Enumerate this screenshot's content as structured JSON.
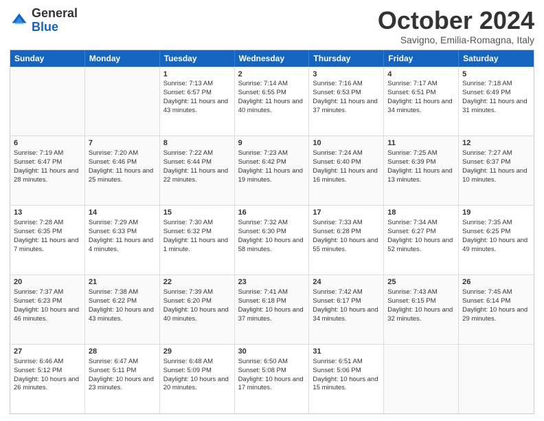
{
  "logo": {
    "general": "General",
    "blue": "Blue"
  },
  "title": "October 2024",
  "location": "Savigno, Emilia-Romagna, Italy",
  "days": [
    "Sunday",
    "Monday",
    "Tuesday",
    "Wednesday",
    "Thursday",
    "Friday",
    "Saturday"
  ],
  "weeks": [
    [
      {
        "day": "",
        "sunrise": "",
        "sunset": "",
        "daylight": "",
        "empty": true
      },
      {
        "day": "",
        "sunrise": "",
        "sunset": "",
        "daylight": "",
        "empty": true
      },
      {
        "day": "1",
        "sunrise": "Sunrise: 7:13 AM",
        "sunset": "Sunset: 6:57 PM",
        "daylight": "Daylight: 11 hours and 43 minutes."
      },
      {
        "day": "2",
        "sunrise": "Sunrise: 7:14 AM",
        "sunset": "Sunset: 6:55 PM",
        "daylight": "Daylight: 11 hours and 40 minutes."
      },
      {
        "day": "3",
        "sunrise": "Sunrise: 7:16 AM",
        "sunset": "Sunset: 6:53 PM",
        "daylight": "Daylight: 11 hours and 37 minutes."
      },
      {
        "day": "4",
        "sunrise": "Sunrise: 7:17 AM",
        "sunset": "Sunset: 6:51 PM",
        "daylight": "Daylight: 11 hours and 34 minutes."
      },
      {
        "day": "5",
        "sunrise": "Sunrise: 7:18 AM",
        "sunset": "Sunset: 6:49 PM",
        "daylight": "Daylight: 11 hours and 31 minutes."
      }
    ],
    [
      {
        "day": "6",
        "sunrise": "Sunrise: 7:19 AM",
        "sunset": "Sunset: 6:47 PM",
        "daylight": "Daylight: 11 hours and 28 minutes."
      },
      {
        "day": "7",
        "sunrise": "Sunrise: 7:20 AM",
        "sunset": "Sunset: 6:46 PM",
        "daylight": "Daylight: 11 hours and 25 minutes."
      },
      {
        "day": "8",
        "sunrise": "Sunrise: 7:22 AM",
        "sunset": "Sunset: 6:44 PM",
        "daylight": "Daylight: 11 hours and 22 minutes."
      },
      {
        "day": "9",
        "sunrise": "Sunrise: 7:23 AM",
        "sunset": "Sunset: 6:42 PM",
        "daylight": "Daylight: 11 hours and 19 minutes."
      },
      {
        "day": "10",
        "sunrise": "Sunrise: 7:24 AM",
        "sunset": "Sunset: 6:40 PM",
        "daylight": "Daylight: 11 hours and 16 minutes."
      },
      {
        "day": "11",
        "sunrise": "Sunrise: 7:25 AM",
        "sunset": "Sunset: 6:39 PM",
        "daylight": "Daylight: 11 hours and 13 minutes."
      },
      {
        "day": "12",
        "sunrise": "Sunrise: 7:27 AM",
        "sunset": "Sunset: 6:37 PM",
        "daylight": "Daylight: 11 hours and 10 minutes."
      }
    ],
    [
      {
        "day": "13",
        "sunrise": "Sunrise: 7:28 AM",
        "sunset": "Sunset: 6:35 PM",
        "daylight": "Daylight: 11 hours and 7 minutes."
      },
      {
        "day": "14",
        "sunrise": "Sunrise: 7:29 AM",
        "sunset": "Sunset: 6:33 PM",
        "daylight": "Daylight: 11 hours and 4 minutes."
      },
      {
        "day": "15",
        "sunrise": "Sunrise: 7:30 AM",
        "sunset": "Sunset: 6:32 PM",
        "daylight": "Daylight: 11 hours and 1 minute."
      },
      {
        "day": "16",
        "sunrise": "Sunrise: 7:32 AM",
        "sunset": "Sunset: 6:30 PM",
        "daylight": "Daylight: 10 hours and 58 minutes."
      },
      {
        "day": "17",
        "sunrise": "Sunrise: 7:33 AM",
        "sunset": "Sunset: 6:28 PM",
        "daylight": "Daylight: 10 hours and 55 minutes."
      },
      {
        "day": "18",
        "sunrise": "Sunrise: 7:34 AM",
        "sunset": "Sunset: 6:27 PM",
        "daylight": "Daylight: 10 hours and 52 minutes."
      },
      {
        "day": "19",
        "sunrise": "Sunrise: 7:35 AM",
        "sunset": "Sunset: 6:25 PM",
        "daylight": "Daylight: 10 hours and 49 minutes."
      }
    ],
    [
      {
        "day": "20",
        "sunrise": "Sunrise: 7:37 AM",
        "sunset": "Sunset: 6:23 PM",
        "daylight": "Daylight: 10 hours and 46 minutes."
      },
      {
        "day": "21",
        "sunrise": "Sunrise: 7:38 AM",
        "sunset": "Sunset: 6:22 PM",
        "daylight": "Daylight: 10 hours and 43 minutes."
      },
      {
        "day": "22",
        "sunrise": "Sunrise: 7:39 AM",
        "sunset": "Sunset: 6:20 PM",
        "daylight": "Daylight: 10 hours and 40 minutes."
      },
      {
        "day": "23",
        "sunrise": "Sunrise: 7:41 AM",
        "sunset": "Sunset: 6:18 PM",
        "daylight": "Daylight: 10 hours and 37 minutes."
      },
      {
        "day": "24",
        "sunrise": "Sunrise: 7:42 AM",
        "sunset": "Sunset: 6:17 PM",
        "daylight": "Daylight: 10 hours and 34 minutes."
      },
      {
        "day": "25",
        "sunrise": "Sunrise: 7:43 AM",
        "sunset": "Sunset: 6:15 PM",
        "daylight": "Daylight: 10 hours and 32 minutes."
      },
      {
        "day": "26",
        "sunrise": "Sunrise: 7:45 AM",
        "sunset": "Sunset: 6:14 PM",
        "daylight": "Daylight: 10 hours and 29 minutes."
      }
    ],
    [
      {
        "day": "27",
        "sunrise": "Sunrise: 6:46 AM",
        "sunset": "Sunset: 5:12 PM",
        "daylight": "Daylight: 10 hours and 26 minutes."
      },
      {
        "day": "28",
        "sunrise": "Sunrise: 6:47 AM",
        "sunset": "Sunset: 5:11 PM",
        "daylight": "Daylight: 10 hours and 23 minutes."
      },
      {
        "day": "29",
        "sunrise": "Sunrise: 6:48 AM",
        "sunset": "Sunset: 5:09 PM",
        "daylight": "Daylight: 10 hours and 20 minutes."
      },
      {
        "day": "30",
        "sunrise": "Sunrise: 6:50 AM",
        "sunset": "Sunset: 5:08 PM",
        "daylight": "Daylight: 10 hours and 17 minutes."
      },
      {
        "day": "31",
        "sunrise": "Sunrise: 6:51 AM",
        "sunset": "Sunset: 5:06 PM",
        "daylight": "Daylight: 10 hours and 15 minutes."
      },
      {
        "day": "",
        "sunrise": "",
        "sunset": "",
        "daylight": "",
        "empty": true
      },
      {
        "day": "",
        "sunrise": "",
        "sunset": "",
        "daylight": "",
        "empty": true
      }
    ]
  ]
}
